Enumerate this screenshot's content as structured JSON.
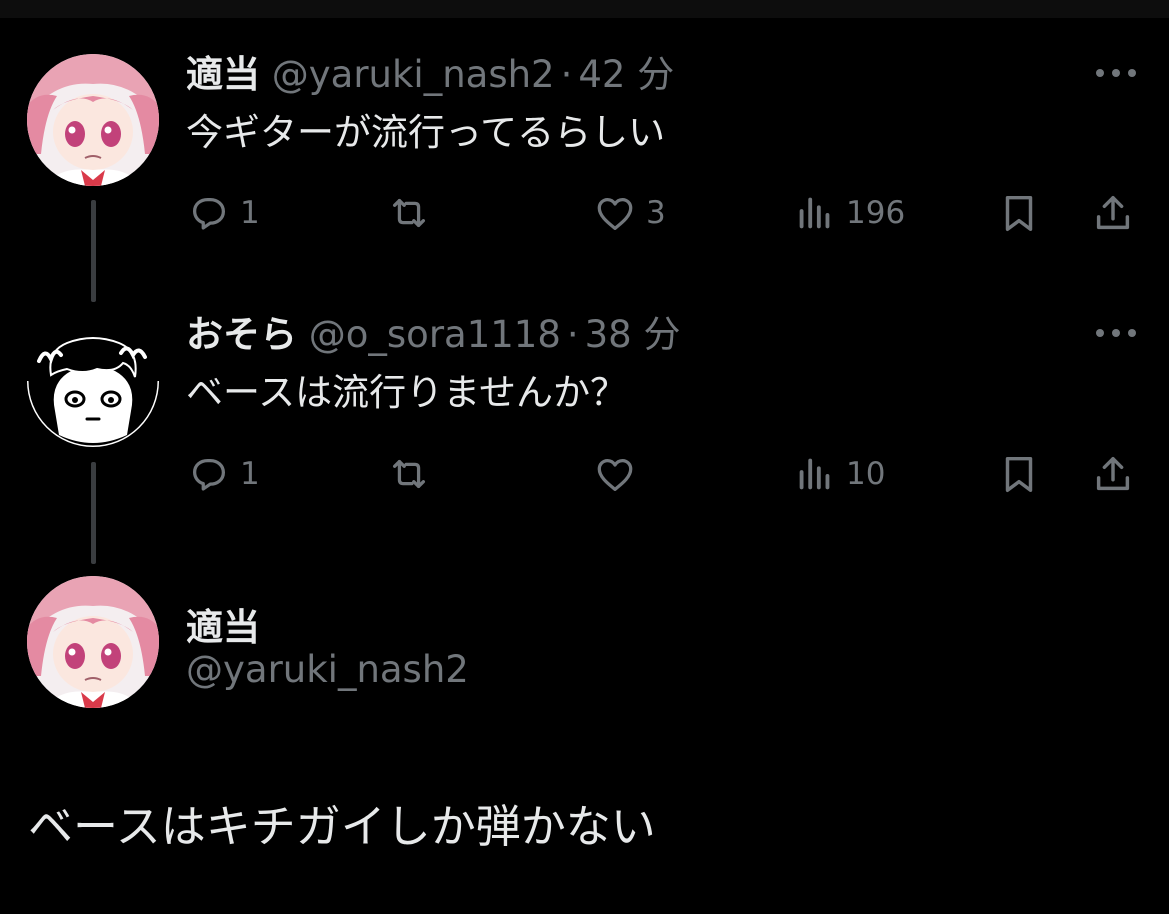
{
  "colors": {
    "background": "#000000",
    "text": "#e7e9ea",
    "muted": "#71767b",
    "thread_line": "#3a3d40"
  },
  "tweets": [
    {
      "name": "適当",
      "handle": "@yaruki_nash2",
      "separator": "·",
      "time": "42 分",
      "text": "今ギターが流行ってるらしい",
      "actions": {
        "reply": "1",
        "retweet": "",
        "like": "3",
        "views": "196"
      },
      "avatar": "anime-pink-hair-girl"
    },
    {
      "name": "おそら",
      "handle": "@o_sora1118",
      "separator": "·",
      "time": "38 分",
      "text": "ベースは流行りませんか？",
      "actions": {
        "reply": "1",
        "retweet": "",
        "like": "",
        "views": "10"
      },
      "avatar": "lineart-dark-hair-boy"
    }
  ],
  "main_tweet": {
    "name": "適当",
    "handle": "@yaruki_nash2",
    "text": "ベースはキチガイしか弾かない",
    "avatar": "anime-pink-hair-girl"
  },
  "icons": [
    "reply-icon",
    "retweet-icon",
    "like-icon",
    "views-icon",
    "bookmark-icon",
    "share-icon",
    "more-icon"
  ]
}
